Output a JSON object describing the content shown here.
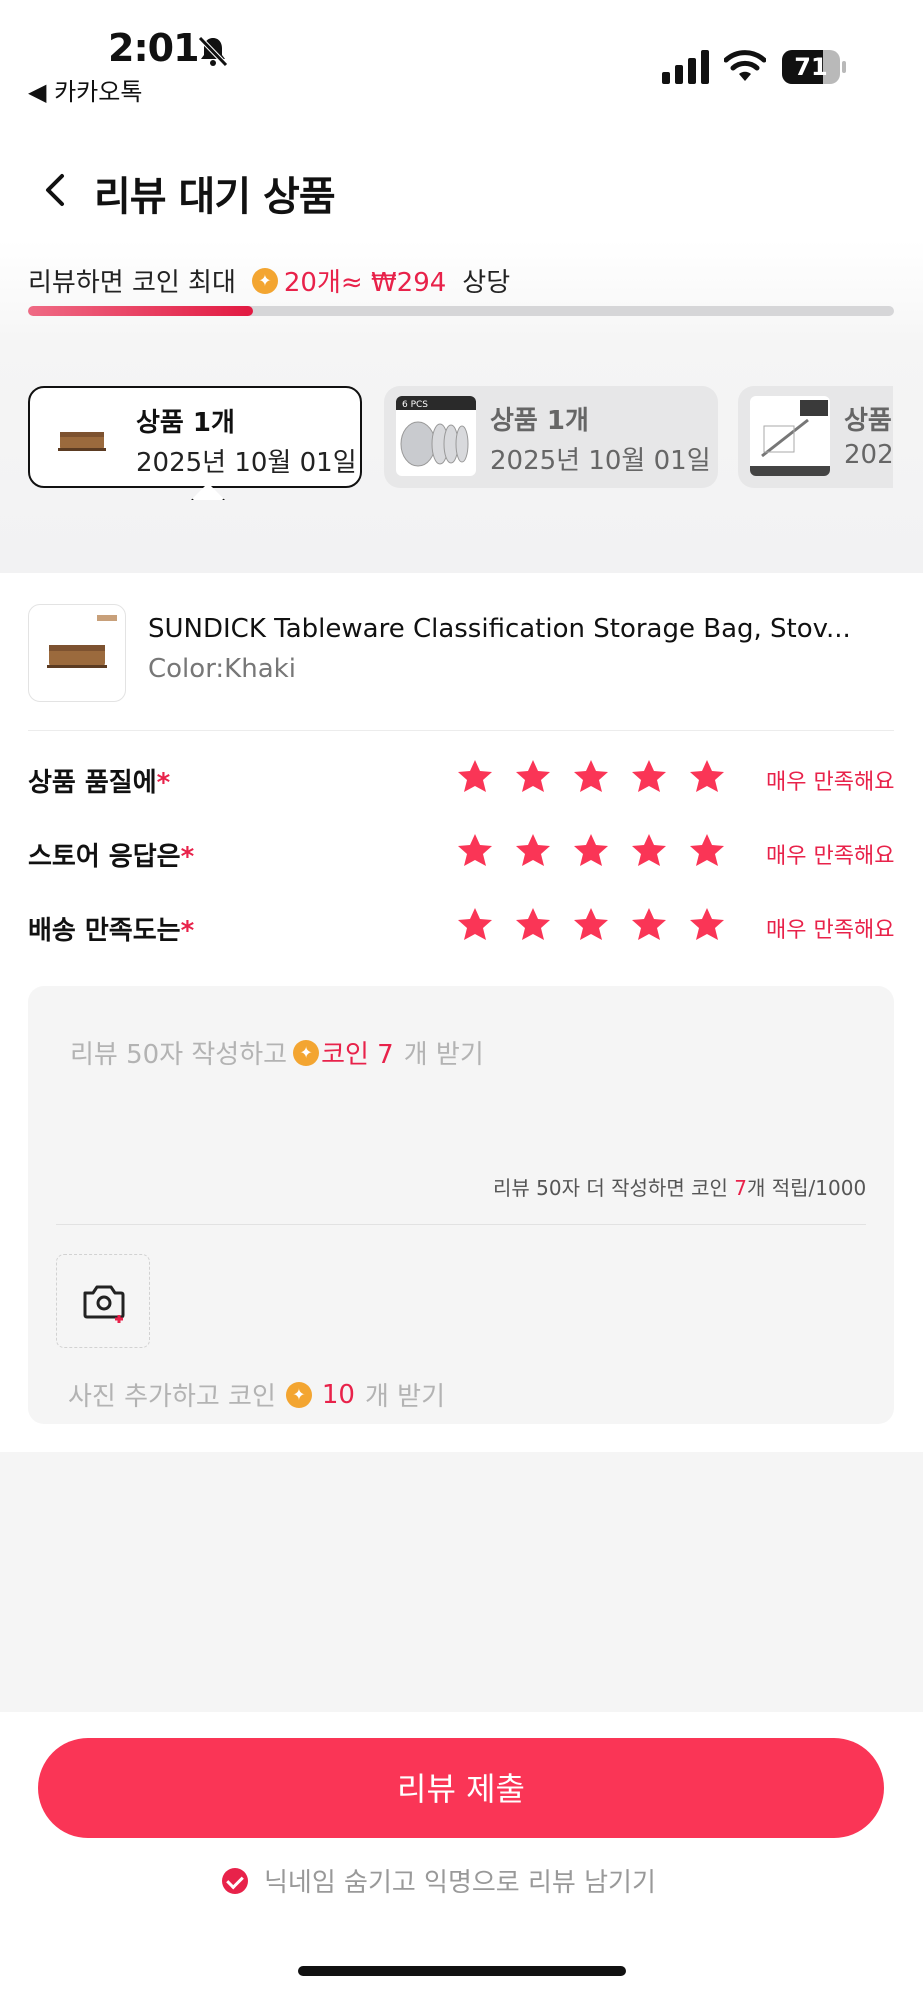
{
  "status_bar": {
    "time": "2:01",
    "back_app": "◀ 카카오톡",
    "battery": "71"
  },
  "header": {
    "title": "리뷰 대기 상품"
  },
  "reward": {
    "prefix": "리뷰하면 코인 최대",
    "coin_icon": "✦",
    "highlight": "20개≈ ₩294",
    "suffix": "상당",
    "progress_fraction": 0.26
  },
  "product_tabs": [
    {
      "title": "상품 1개",
      "date": "2025년 10월 01일",
      "active": true,
      "thumb": "khaki-bag"
    },
    {
      "title": "상품 1개",
      "date": "2025년 10월 01일",
      "active": false,
      "thumb": "steel-plates",
      "thumb_label": "6 PCS"
    },
    {
      "title": "상품",
      "date": "202",
      "active": false,
      "thumb": "zipper-bag"
    }
  ],
  "product": {
    "name": "SUNDICK Tableware Classification Storage Bag, Stov...",
    "option": "Color:Khaki"
  },
  "ratings": [
    {
      "label": "상품 품질에",
      "required": "*",
      "stars": 5,
      "text": "매우 만족해요"
    },
    {
      "label": "스토어 응답은",
      "required": "*",
      "stars": 5,
      "text": "매우 만족해요"
    },
    {
      "label": "배송 만족도는",
      "required": "*",
      "stars": 5,
      "text": "매우 만족해요"
    }
  ],
  "review": {
    "placeholder_prefix": "리뷰 50자 작성하고",
    "placeholder_coin_word": "코인",
    "placeholder_count": "7",
    "placeholder_suffix": "개 받기",
    "counter_prefix": "리뷰 50자 더 작성하면 코인 ",
    "counter_count": "7",
    "counter_suffix": "개 적립/1000",
    "photo_prefix": "사진 추가하고 코인",
    "photo_count": "10",
    "photo_suffix": "개 받기"
  },
  "submit": {
    "label": "리뷰 제출"
  },
  "anonymous": {
    "label": "닉네임 숨기고 익명으로 리뷰 남기기",
    "checked": true
  },
  "colors": {
    "accent": "#e8224a",
    "button": "#fa3556",
    "coin": "#f3a531"
  }
}
